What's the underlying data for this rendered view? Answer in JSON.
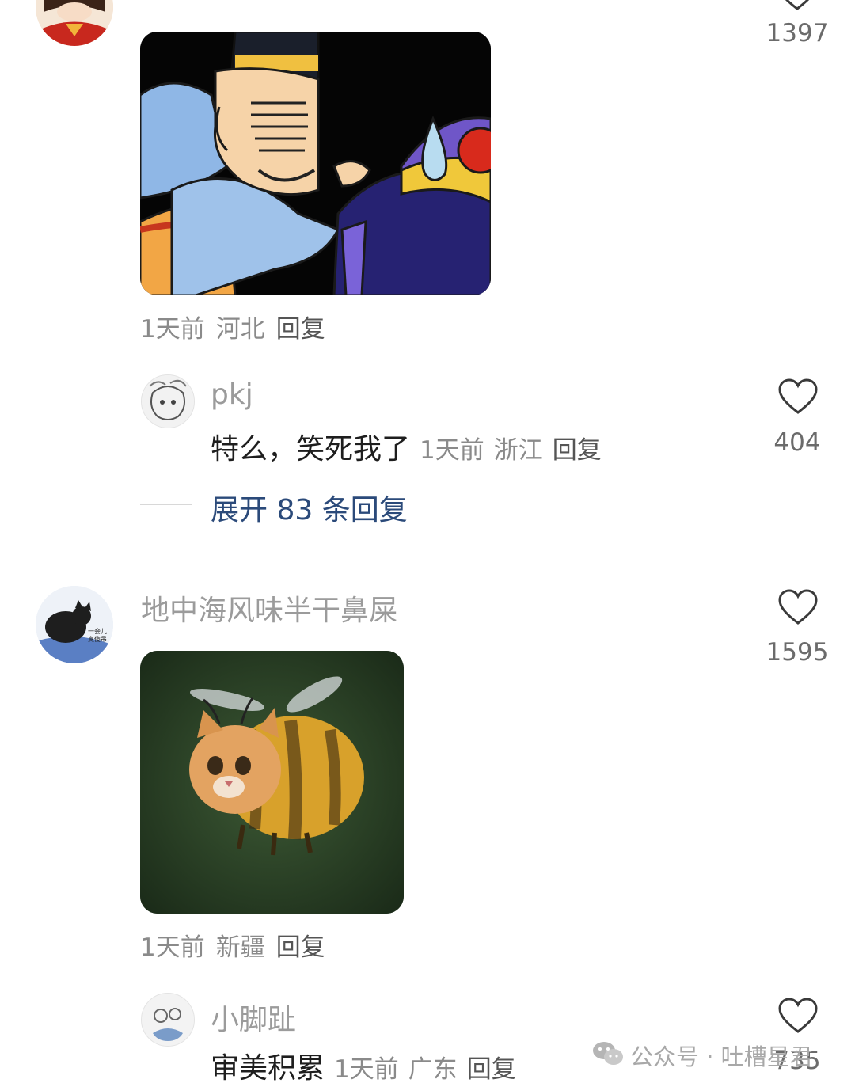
{
  "comments": [
    {
      "likes": "1397",
      "meta": {
        "time": "1天前",
        "location": "河北",
        "reply": "回复"
      },
      "sub_reply": {
        "username": "pkj",
        "text": "特么，笑死我了",
        "time": "1天前",
        "location": "浙江",
        "reply": "回复",
        "likes": "404"
      },
      "expand_label": "展开 83 条回复"
    },
    {
      "username": "地中海风味半干鼻屎",
      "likes": "1595",
      "avatar_caption": "一会儿臭傻吊",
      "meta": {
        "time": "1天前",
        "location": "新疆",
        "reply": "回复"
      },
      "sub_reply": {
        "username": "小脚趾",
        "text": "审美积累",
        "time": "1天前",
        "location": "广东",
        "reply": "回复",
        "likes": "735"
      }
    }
  ],
  "watermark": {
    "label": "公众号 · 吐槽星君",
    "icon": "wechat-icon"
  },
  "colors": {
    "name_gray": "#9b9b9b",
    "expand_blue": "#2b4a7a",
    "meta_gray": "#8a8a8a"
  }
}
